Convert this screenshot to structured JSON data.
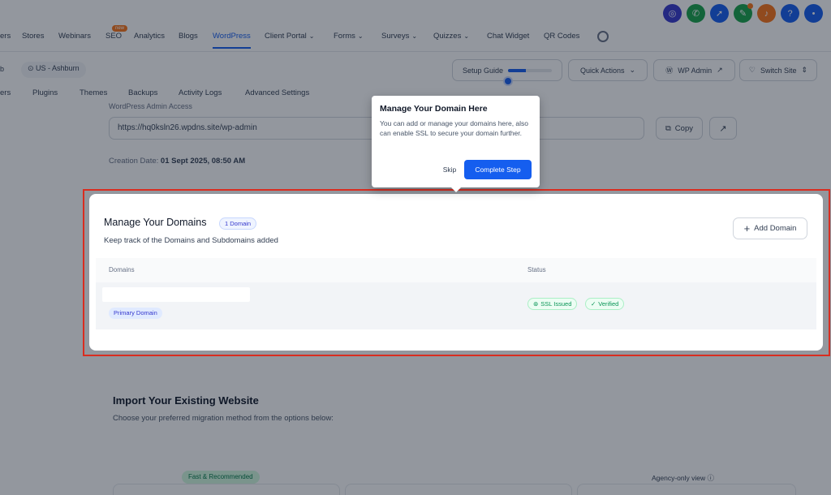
{
  "top_icons": [
    {
      "icon": "help-circle-icon",
      "color": "#3538cd",
      "glyph": "◎"
    },
    {
      "icon": "phone-icon",
      "color": "#16a34a",
      "glyph": "✆"
    },
    {
      "icon": "megaphone-icon",
      "color": "#155eef",
      "glyph": "➚"
    },
    {
      "icon": "notes-icon",
      "color": "#16a34a",
      "glyph": "✎"
    },
    {
      "icon": "bell-icon",
      "color": "#f97316",
      "glyph": "♪"
    },
    {
      "icon": "help-icon",
      "color": "#155eef",
      "glyph": "?"
    },
    {
      "icon": "user-avatar-icon",
      "color": "#155eef",
      "glyph": "•"
    }
  ],
  "main_nav": {
    "items": [
      {
        "label": "ers",
        "chev": false
      },
      {
        "label": "Stores",
        "chev": false
      },
      {
        "label": "Webinars",
        "chev": false
      },
      {
        "label": "SEO",
        "chev": false
      },
      {
        "label": "Analytics",
        "chev": false
      },
      {
        "label": "Blogs",
        "chev": false
      },
      {
        "label": "WordPress",
        "chev": false,
        "active": true
      },
      {
        "label": "Client Portal",
        "chev": true
      },
      {
        "label": "Forms",
        "chev": true
      },
      {
        "label": "Surveys",
        "chev": true
      },
      {
        "label": "Quizzes",
        "chev": true
      },
      {
        "label": "Chat Widget",
        "chev": false
      },
      {
        "label": "QR Codes",
        "chev": false
      }
    ],
    "seo_badge": "new"
  },
  "subheader": {
    "left_fragment": "b",
    "location": "US - Ashburn",
    "setup_guide": "Setup Guide",
    "setup_progress": 0.4,
    "quick_actions": "Quick Actions",
    "wp_admin": "WP Admin",
    "switch_site": "Switch Site"
  },
  "sub_tabs": [
    "ers",
    "Plugins",
    "Themes",
    "Backups",
    "Activity Logs",
    "Advanced Settings"
  ],
  "access": {
    "label": "WordPress Admin Access",
    "url": "https://hq0ksln26.wpdns.site/wp-admin",
    "copy_label": "Copy"
  },
  "creation": {
    "label": "Creation Date:",
    "value": "01 Sept 2025, 08:50 AM"
  },
  "import": {
    "title": "Import Your Existing Website",
    "subtitle": "Choose your preferred migration method from the options below:",
    "chip": "Fast & Recommended",
    "agency": "Agency-only view"
  },
  "domains": {
    "title": "Manage Your Domains",
    "count_badge": "1 Domain",
    "subtitle": "Keep track of the Domains and Subdomains added",
    "add_button": "Add Domain",
    "columns": {
      "domains": "Domains",
      "status": "Status"
    },
    "rows": [
      {
        "domain": "",
        "primary_label": "Primary Domain",
        "ssl": "SSL Issued",
        "verified": "Verified"
      }
    ]
  },
  "tooltip": {
    "title": "Manage Your Domain Here",
    "body": "You can add or manage your domains here, also can enable SSL to secure your domain further.",
    "skip": "Skip",
    "complete": "Complete Step"
  }
}
